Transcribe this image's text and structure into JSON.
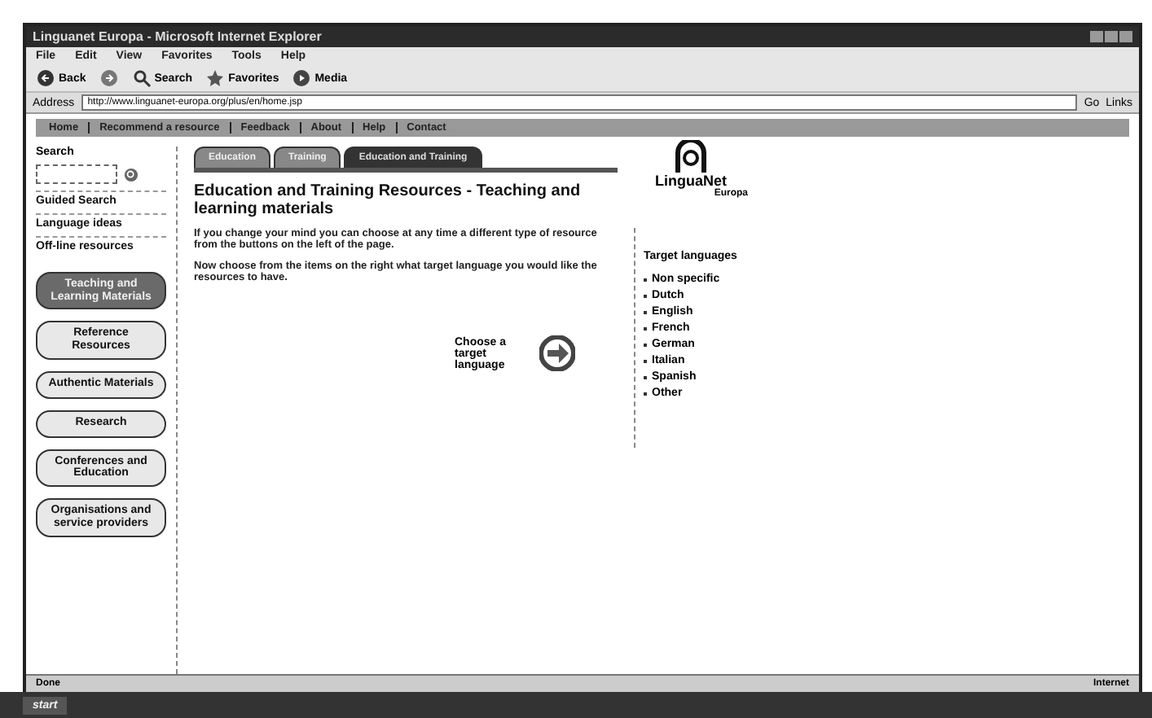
{
  "window": {
    "title": "Linguanet Europa - Microsoft Internet Explorer"
  },
  "menu": [
    "File",
    "Edit",
    "View",
    "Favorites",
    "Tools",
    "Help"
  ],
  "toolbar": [
    {
      "kind": "back",
      "label": "Back"
    },
    {
      "kind": "forward"
    },
    {
      "kind": "search",
      "label": "Search"
    },
    {
      "kind": "favorites",
      "label": "Favorites"
    },
    {
      "kind": "media",
      "label": "Media"
    }
  ],
  "address": {
    "label": "Address",
    "value": "http://www.linguanet-europa.org/plus/en/home.jsp",
    "go": "Go",
    "links": "Links"
  },
  "site_nav": [
    "Home",
    "Recommend a resource",
    "Feedback",
    "About",
    "Help",
    "Contact"
  ],
  "sidebar": {
    "search_label": "Search",
    "links": [
      "Guided Search",
      "Language ideas",
      "Off-line resources"
    ],
    "buttons": [
      {
        "label": "Teaching and Learning Materials",
        "selected": true
      },
      {
        "label": "Reference Resources",
        "selected": false
      },
      {
        "label": "Authentic Materials",
        "selected": false
      },
      {
        "label": "Research",
        "selected": false
      },
      {
        "label": "Conferences and Education",
        "selected": false
      },
      {
        "label": "Organisations and service providers",
        "selected": false
      }
    ]
  },
  "tabs": [
    {
      "label": "Education",
      "selected": false
    },
    {
      "label": "Training",
      "selected": false
    },
    {
      "label": "Education and Training",
      "selected": true
    }
  ],
  "heading": "Education and Training Resources - Teaching and learning materials",
  "paragraphs": [
    "If you change your mind you can choose at any time a different type of resource from the buttons on the left of the page.",
    "Now choose from the items on the right what target language you would like the resources to have."
  ],
  "prompt": "Choose a target language",
  "logo": {
    "name": "LinguaNet",
    "sub": "Europa"
  },
  "languages": {
    "title": "Target languages",
    "items": [
      "Non specific",
      "Dutch",
      "English",
      "French",
      "German",
      "Italian",
      "Spanish",
      "Other"
    ]
  },
  "status_bar": {
    "left": "Done",
    "right": "Internet"
  },
  "taskbar": {
    "start": "start"
  }
}
